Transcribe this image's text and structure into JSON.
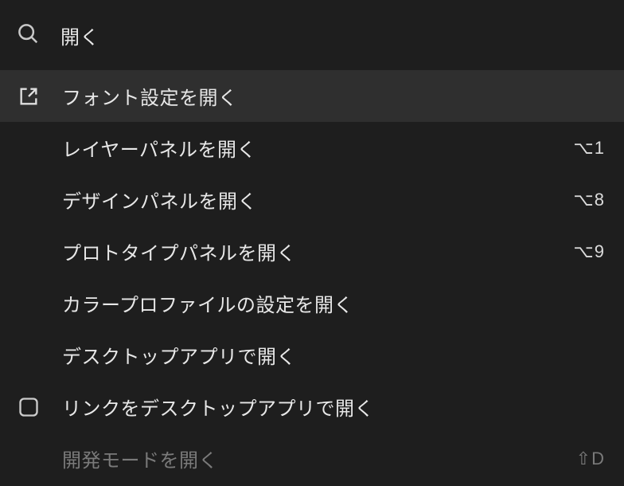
{
  "search": {
    "value": "開く"
  },
  "menu": {
    "items": [
      {
        "label": "フォント設定を開く",
        "shortcut": "",
        "icon": "external",
        "selected": true,
        "disabled": false
      },
      {
        "label": "レイヤーパネルを開く",
        "shortcut": "⌥1",
        "icon": "",
        "selected": false,
        "disabled": false
      },
      {
        "label": "デザインパネルを開く",
        "shortcut": "⌥8",
        "icon": "",
        "selected": false,
        "disabled": false
      },
      {
        "label": "プロトタイプパネルを開く",
        "shortcut": "⌥9",
        "icon": "",
        "selected": false,
        "disabled": false
      },
      {
        "label": "カラープロファイルの設定を開く",
        "shortcut": "",
        "icon": "",
        "selected": false,
        "disabled": false
      },
      {
        "label": "デスクトップアプリで開く",
        "shortcut": "",
        "icon": "",
        "selected": false,
        "disabled": false
      },
      {
        "label": "リンクをデスクトップアプリで開く",
        "shortcut": "",
        "icon": "checkbox",
        "selected": false,
        "disabled": false
      },
      {
        "label": "開発モードを開く",
        "shortcut": "⇧D",
        "icon": "",
        "selected": false,
        "disabled": true
      }
    ]
  }
}
